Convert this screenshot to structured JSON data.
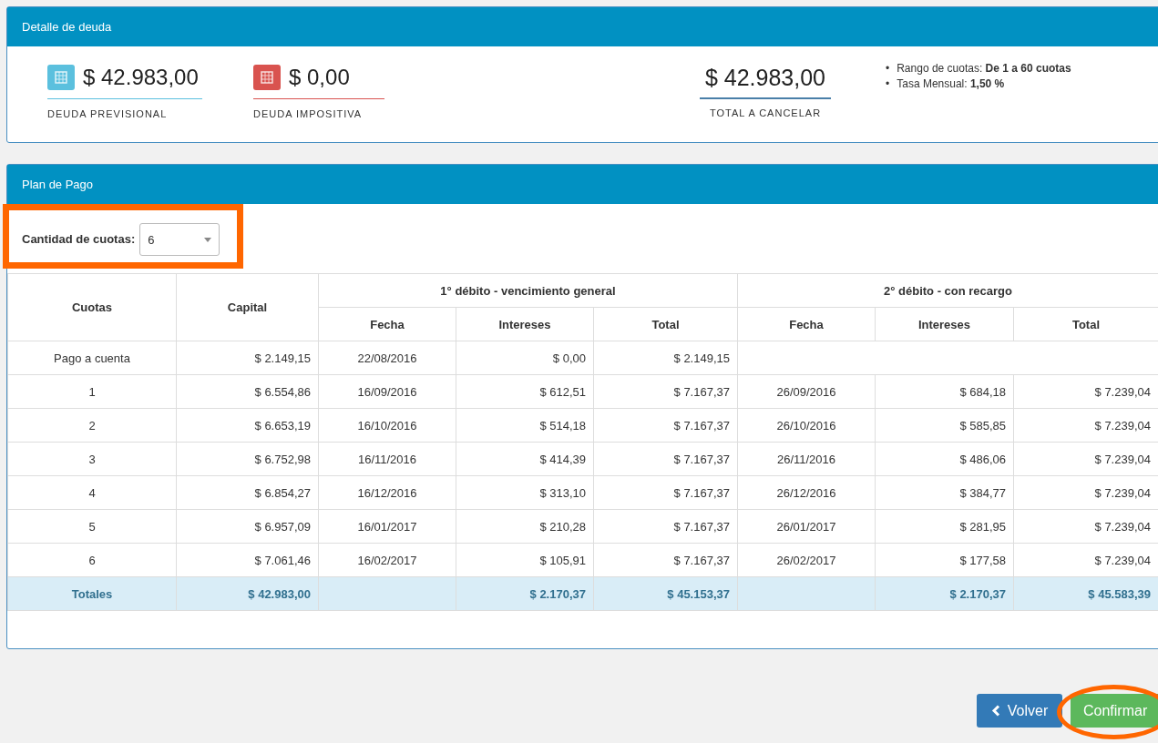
{
  "debt_panel": {
    "title": "Detalle de deuda",
    "cards": [
      {
        "amount": "$ 42.983,00",
        "label": "DEUDA PREVISIONAL",
        "color": "#5bc0de"
      },
      {
        "amount": "$ 0,00",
        "label": "DEUDA IMPOSITIVA",
        "color": "#d9534f"
      }
    ],
    "total": {
      "amount": "$ 42.983,00",
      "label": "TOTAL A CANCELAR"
    },
    "info": [
      {
        "bullet": "•",
        "text": "Rango de cuotas: **De 1 a 60 cuotas**"
      },
      {
        "bullet": "•",
        "text": "Tasa Mensual: **1,50 %**"
      }
    ]
  },
  "plan_panel": {
    "title": "Plan de Pago",
    "installments_select": {
      "label": "Cantidad de cuotas:",
      "value": "6"
    },
    "table": {
      "columns": [
        "Cuotas",
        "Capital"
      ],
      "groups": [
        {
          "title": "1° débito - vencimiento general",
          "columns": [
            "Fecha",
            "Intereses",
            "Total"
          ]
        },
        {
          "title": "2° débito - con recargo",
          "columns": [
            "Fecha",
            "Intereses",
            "Total"
          ]
        }
      ],
      "rows": [
        {
          "kind": "row",
          "cuota": "Pago a cuenta",
          "capital": "$ 2.149,15",
          "d1": {
            "fecha": "22/08/2016",
            "intereses": "$ 0,00",
            "total": "$ 2.149,15"
          }
        },
        {
          "kind": "row",
          "cuota": "1",
          "capital": "$ 6.554,86",
          "d1": {
            "fecha": "16/09/2016",
            "intereses": "$ 612,51",
            "total": "$ 7.167,37"
          },
          "d2": {
            "fecha": "26/09/2016",
            "intereses": "$ 684,18",
            "total": "$ 7.239,04"
          }
        },
        {
          "kind": "row",
          "cuota": "2",
          "capital": "$ 6.653,19",
          "d1": {
            "fecha": "16/10/2016",
            "intereses": "$ 514,18",
            "total": "$ 7.167,37"
          },
          "d2": {
            "fecha": "26/10/2016",
            "intereses": "$ 585,85",
            "total": "$ 7.239,04"
          }
        },
        {
          "kind": "row",
          "cuota": "3",
          "capital": "$ 6.752,98",
          "d1": {
            "fecha": "16/11/2016",
            "intereses": "$ 414,39",
            "total": "$ 7.167,37"
          },
          "d2": {
            "fecha": "26/11/2016",
            "intereses": "$ 486,06",
            "total": "$ 7.239,04"
          }
        },
        {
          "kind": "row",
          "cuota": "4",
          "capital": "$ 6.854,27",
          "d1": {
            "fecha": "16/12/2016",
            "intereses": "$ 313,10",
            "total": "$ 7.167,37"
          },
          "d2": {
            "fecha": "26/12/2016",
            "intereses": "$ 384,77",
            "total": "$ 7.239,04"
          }
        },
        {
          "kind": "row",
          "cuota": "5",
          "capital": "$ 6.957,09",
          "d1": {
            "fecha": "16/01/2017",
            "intereses": "$ 210,28",
            "total": "$ 7.167,37"
          },
          "d2": {
            "fecha": "26/01/2017",
            "intereses": "$ 281,95",
            "total": "$ 7.239,04"
          }
        },
        {
          "kind": "row",
          "cuota": "6",
          "capital": "$ 7.061,46",
          "d1": {
            "fecha": "16/02/2017",
            "intereses": "$ 105,91",
            "total": "$ 7.167,37"
          },
          "d2": {
            "fecha": "26/02/2017",
            "intereses": "$ 177,58",
            "total": "$ 7.239,04"
          }
        },
        {
          "kind": "total",
          "cuota": "Totales",
          "capital": "$ 42.983,00",
          "d1": {
            "intereses": "$ 2.170,37",
            "total": "$ 45.153,37"
          },
          "d2": {
            "intereses": "$ 2.170,37",
            "total": "$ 45.583,39"
          }
        }
      ]
    }
  },
  "buttons": [
    {
      "kind": "back",
      "label": "Volver"
    },
    {
      "kind": "confirm",
      "label": "Confirmar"
    }
  ]
}
